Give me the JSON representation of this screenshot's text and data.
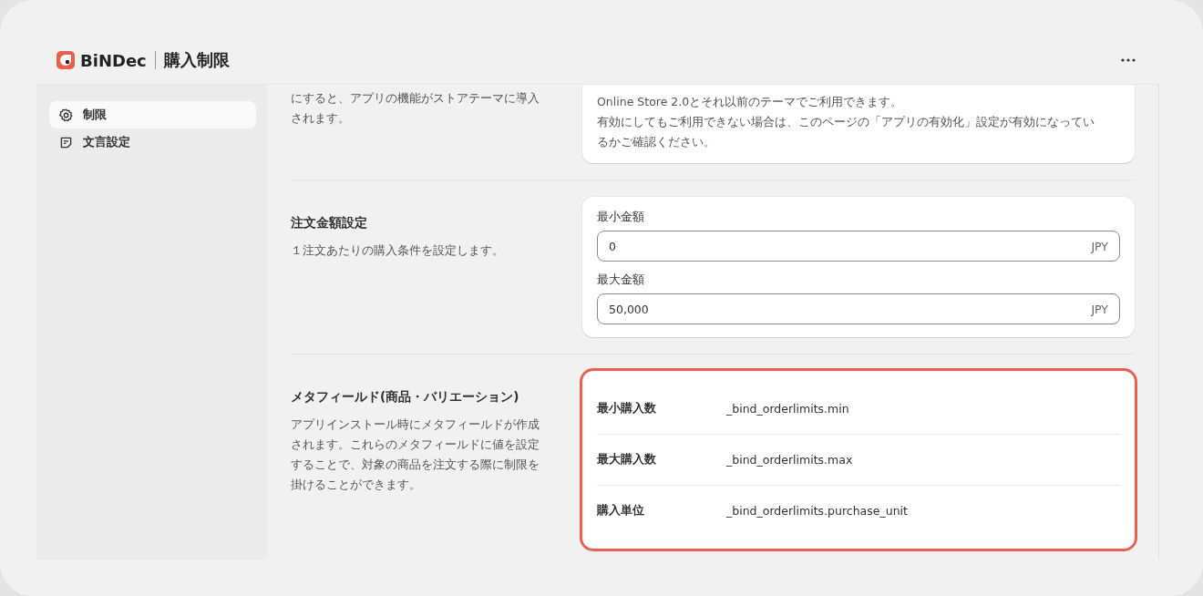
{
  "app": {
    "brand": "BiNDec",
    "title": "購入制限"
  },
  "sidebar": {
    "items": [
      {
        "label": "制限",
        "selected": true
      },
      {
        "label": "文言設定",
        "selected": false
      }
    ]
  },
  "sections": [
    {
      "kind": "note",
      "description": [
        "にすると、アプリの機能がストアテーマに導入",
        "されます。"
      ],
      "card_lines": [
        "Online Store 2.0とそれ以前のテーマでご利用できます。",
        "有効にしてもご利用できない場合は、このページの「アプリの有効化」設定が有効になってい",
        "るかご確認ください。"
      ]
    },
    {
      "kind": "fields",
      "title": "注文金額設定",
      "description": [
        "１注文あたりの購入条件を設定します。"
      ],
      "fields": [
        {
          "label": "最小金額",
          "value": "0",
          "suffix": "JPY"
        },
        {
          "label": "最大金額",
          "value": "50,000",
          "suffix": "JPY"
        }
      ]
    },
    {
      "kind": "table",
      "title": "メタフィールド(商品・バリエーション)",
      "description": [
        "アプリインストール時にメタフィールドが作成",
        "されます。これらのメタフィールドに値を設定",
        "することで、対象の商品を注文する際に制限を",
        "掛けることができます。"
      ],
      "highlighted": true,
      "rows": [
        {
          "label": "最小購入数",
          "value": "_bind_orderlimits.min"
        },
        {
          "label": "最大購入数",
          "value": "_bind_orderlimits.max"
        },
        {
          "label": "購入単位",
          "value": "_bind_orderlimits.purchase_unit"
        }
      ]
    }
  ]
}
